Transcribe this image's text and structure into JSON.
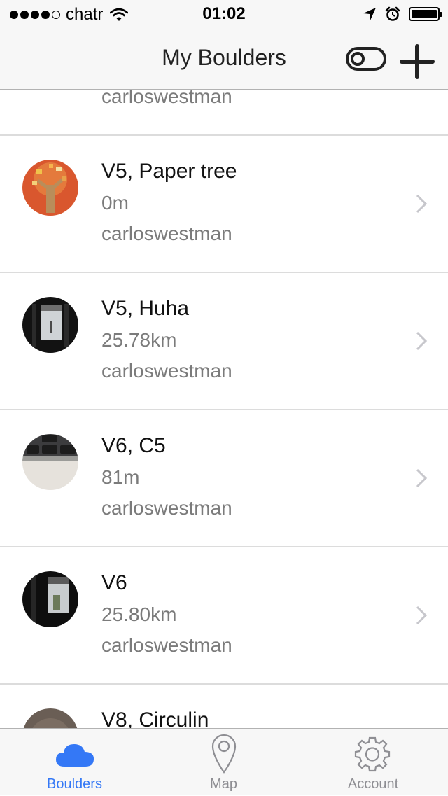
{
  "status_bar": {
    "carrier": "chatr",
    "time": "01:02"
  },
  "nav": {
    "title": "My Boulders"
  },
  "list": {
    "partial_top_user": "carloswestman",
    "items": [
      {
        "name": "V5, Paper tree",
        "distance": "0m",
        "user": "carloswestman"
      },
      {
        "name": "V5, Huha",
        "distance": "25.78km",
        "user": "carloswestman"
      },
      {
        "name": "V6, C5",
        "distance": "81m",
        "user": "carloswestman"
      },
      {
        "name": "V6",
        "distance": "25.80km",
        "user": "carloswestman"
      },
      {
        "name": "V8, Circulin",
        "distance": "",
        "user": ""
      }
    ]
  },
  "tabs": [
    {
      "label": "Boulders",
      "icon": "cloud-icon",
      "active": true
    },
    {
      "label": "Map",
      "icon": "map-pin-icon",
      "active": false
    },
    {
      "label": "Account",
      "icon": "gear-icon",
      "active": false
    }
  ],
  "colors": {
    "accent": "#3478f6",
    "inactive": "#8e8e93",
    "separator": "#dcdcdc"
  }
}
